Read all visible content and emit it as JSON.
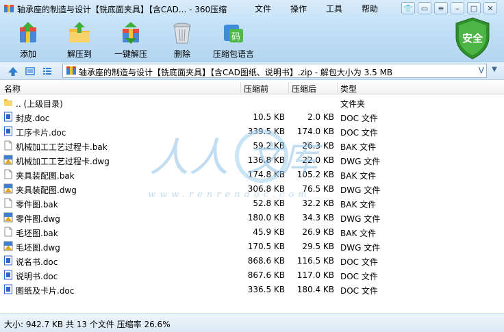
{
  "window": {
    "title": "轴承座的制造与设计【铣底面夹具】【含CAD... - 360压缩",
    "menu": [
      "文件",
      "操作",
      "工具",
      "帮助"
    ]
  },
  "toolbar": [
    {
      "label": "添加",
      "icon": "add-archive-icon"
    },
    {
      "label": "解压到",
      "icon": "extract-to-icon"
    },
    {
      "label": "一键解压",
      "icon": "one-click-extract-icon"
    },
    {
      "label": "删除",
      "icon": "delete-trash-icon"
    },
    {
      "label": "压缩包语言",
      "icon": "archive-language-icon"
    }
  ],
  "shield_label": "安全",
  "shield_icon_text": "码",
  "address": {
    "path": "轴承座的制造与设计【铣底面夹具】【含CAD图纸、说明书】.zip - 解包大小为 3.5 MB",
    "dropdown": "V"
  },
  "columns": {
    "name": "名称",
    "size": "压缩前",
    "packed": "压缩后",
    "type": "类型"
  },
  "files": [
    {
      "name": ".. (上级目录)",
      "size": "",
      "packed": "",
      "type": "文件夹",
      "kind": "folder"
    },
    {
      "name": "封皮.doc",
      "size": "10.5 KB",
      "packed": "2.0 KB",
      "type": "DOC 文件",
      "kind": "doc"
    },
    {
      "name": "工序卡片.doc",
      "size": "339.5 KB",
      "packed": "174.0 KB",
      "type": "DOC 文件",
      "kind": "doc"
    },
    {
      "name": "机械加工工艺过程卡.bak",
      "size": "59.2 KB",
      "packed": "26.3 KB",
      "type": "BAK 文件",
      "kind": "bak"
    },
    {
      "name": "机械加工工艺过程卡.dwg",
      "size": "136.8 KB",
      "packed": "22.0 KB",
      "type": "DWG 文件",
      "kind": "dwg"
    },
    {
      "name": "夹具装配图.bak",
      "size": "174.8 KB",
      "packed": "105.2 KB",
      "type": "BAK 文件",
      "kind": "bak"
    },
    {
      "name": "夹具装配图.dwg",
      "size": "306.8 KB",
      "packed": "76.5 KB",
      "type": "DWG 文件",
      "kind": "dwg"
    },
    {
      "name": "零件图.bak",
      "size": "52.8 KB",
      "packed": "32.2 KB",
      "type": "BAK 文件",
      "kind": "bak"
    },
    {
      "name": "零件图.dwg",
      "size": "180.0 KB",
      "packed": "34.3 KB",
      "type": "DWG 文件",
      "kind": "dwg"
    },
    {
      "name": "毛坯图.bak",
      "size": "45.9 KB",
      "packed": "26.9 KB",
      "type": "BAK 文件",
      "kind": "bak"
    },
    {
      "name": "毛坯图.dwg",
      "size": "170.5 KB",
      "packed": "29.5 KB",
      "type": "DWG 文件",
      "kind": "dwg"
    },
    {
      "name": "说名书.doc",
      "size": "868.6 KB",
      "packed": "116.5 KB",
      "type": "DOC 文件",
      "kind": "doc"
    },
    {
      "name": "说明书.doc",
      "size": "867.6 KB",
      "packed": "117.0 KB",
      "type": "DOC 文件",
      "kind": "doc"
    },
    {
      "name": "图纸及卡片.doc",
      "size": "336.5 KB",
      "packed": "180.4 KB",
      "type": "DOC 文件",
      "kind": "doc"
    }
  ],
  "watermark": {
    "text": "人人文库",
    "url": "www.renrendoc.com"
  },
  "status": "大小: 942.7 KB 共 13 个文件 压缩率 26.6%",
  "colors": {
    "accent": "#1f6fc2",
    "toolbar_bg": "#c4e1f7",
    "shield": "#3aa335",
    "doc_icon": "#2c64c8",
    "dwg_icon": "#e0a91e"
  }
}
